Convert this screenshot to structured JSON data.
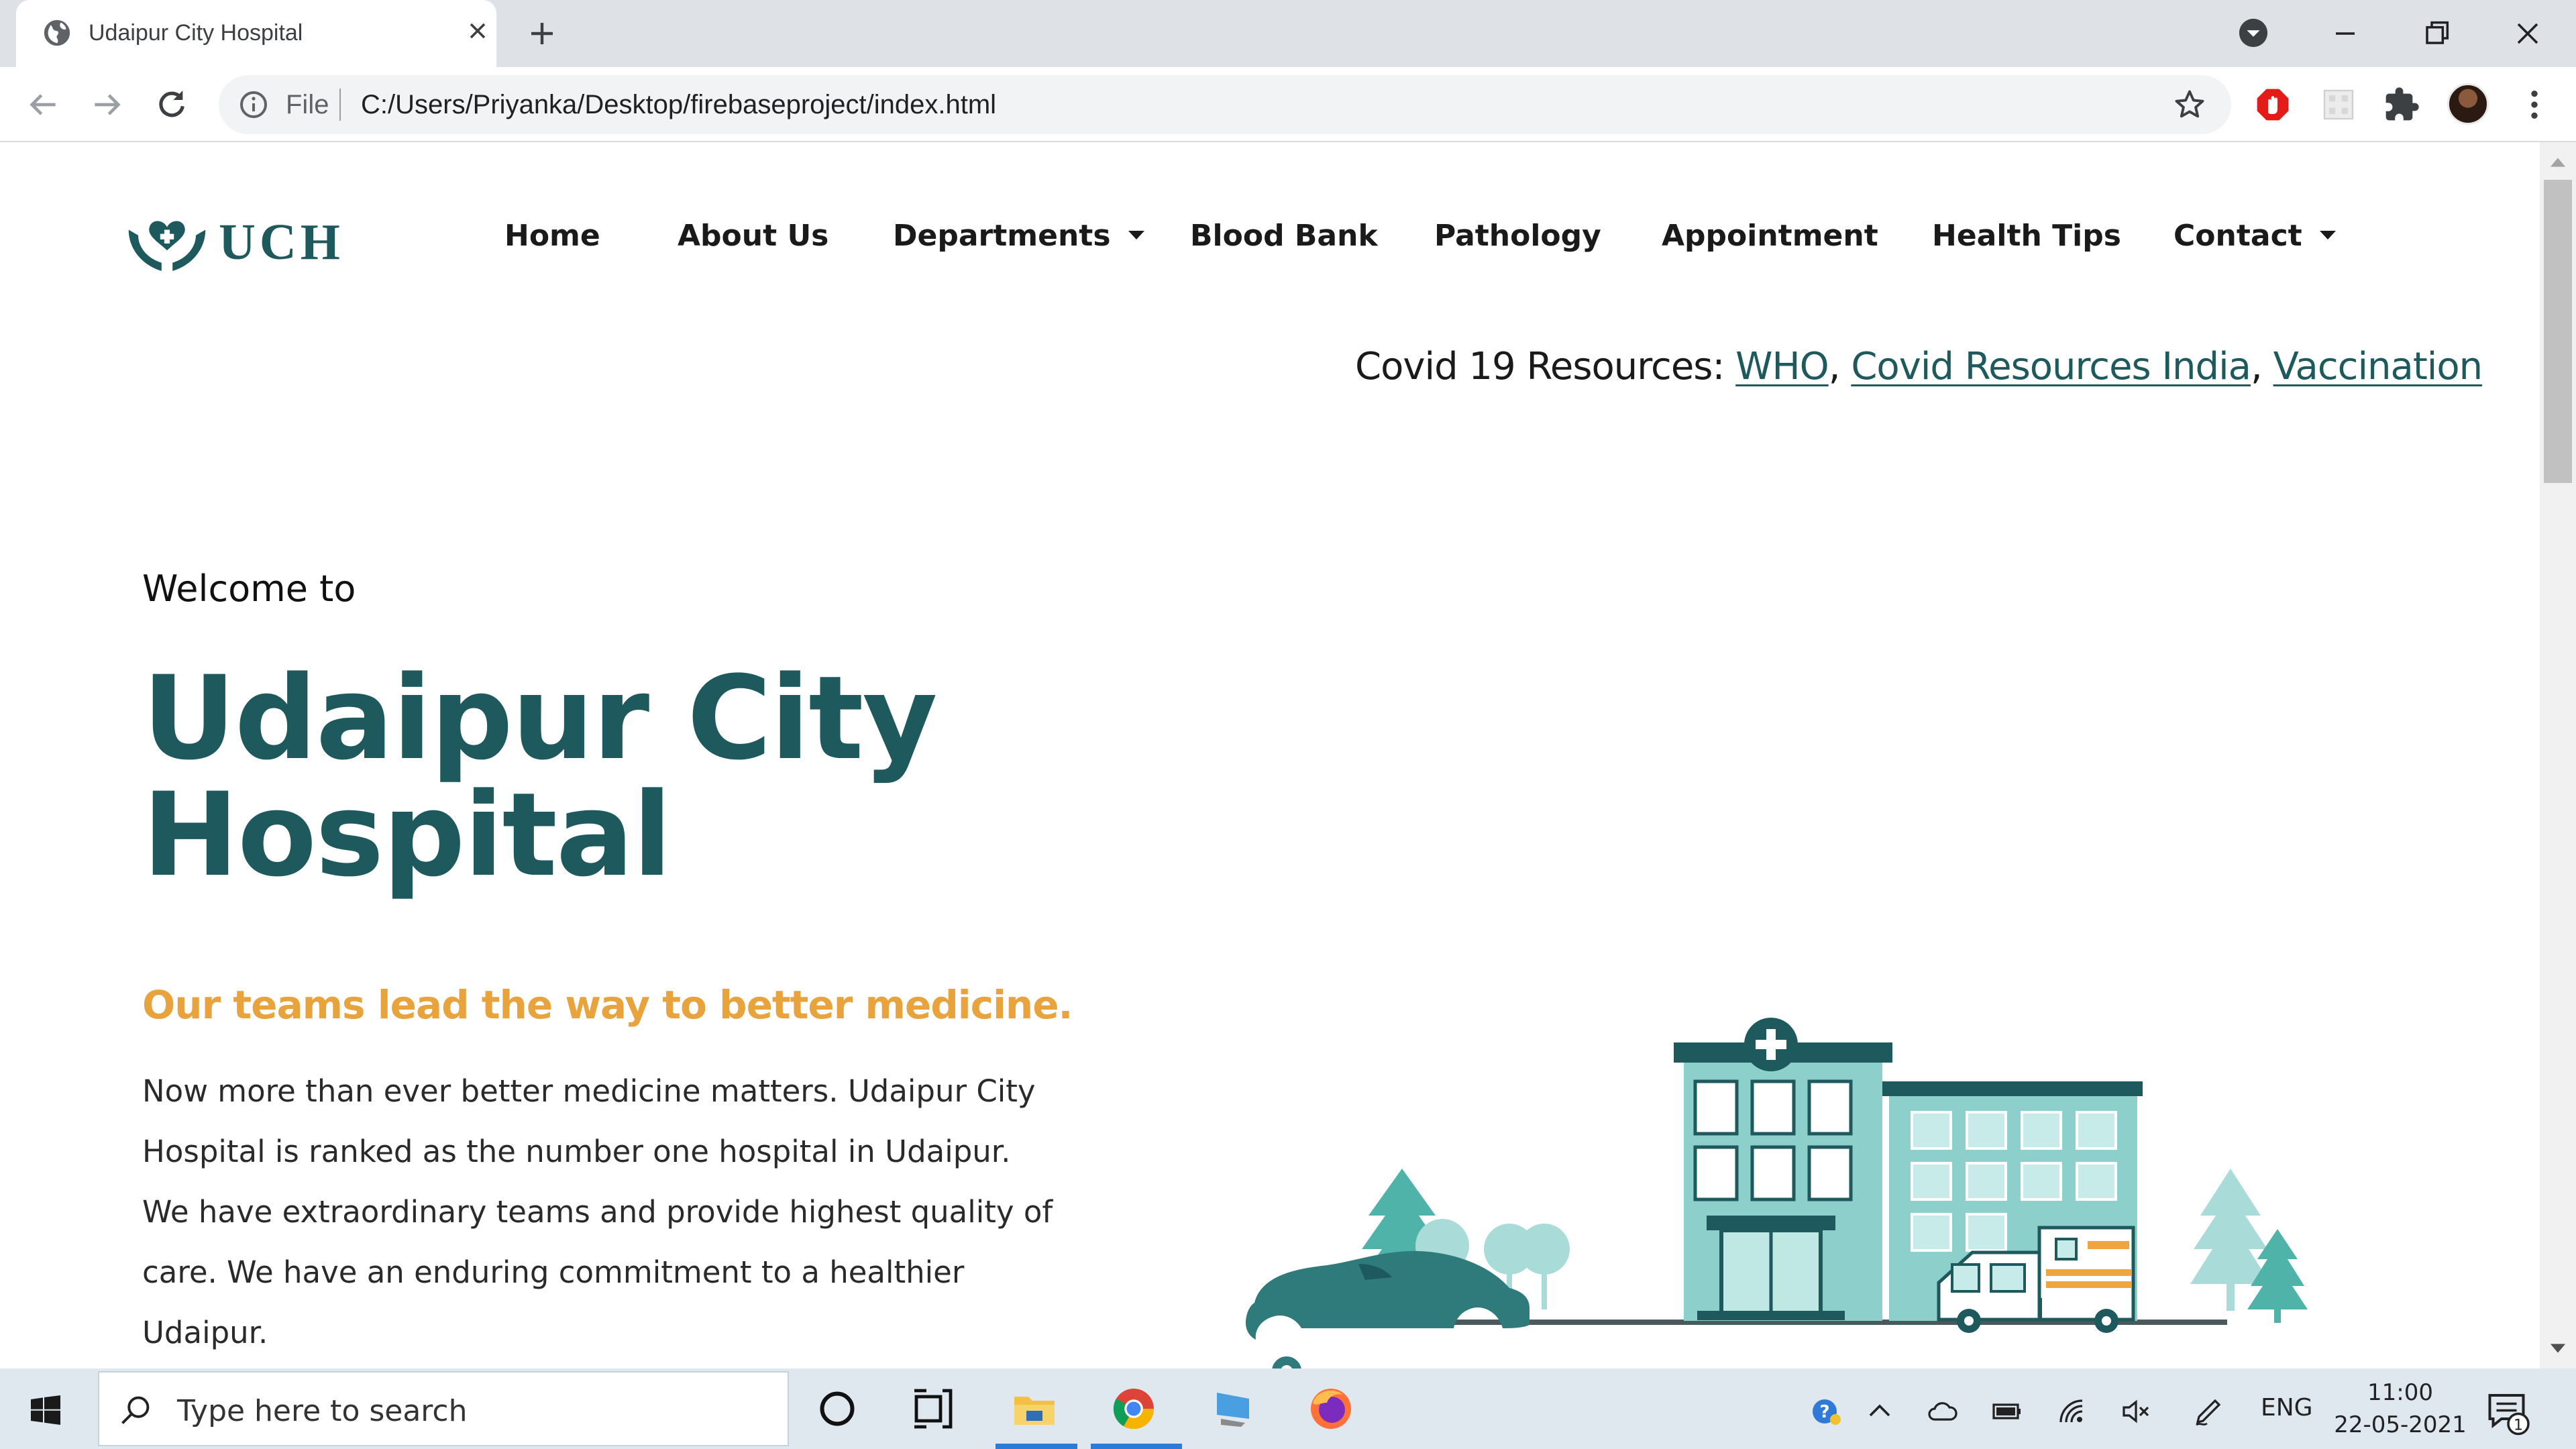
{
  "browser": {
    "tab_title": "Udaipur City Hospital",
    "omnibox_scheme": "File",
    "url": "C:/Users/Priyanka/Desktop/firebaseproject/index.html"
  },
  "site": {
    "logo_text": "UCH",
    "nav": [
      {
        "label": "Home"
      },
      {
        "label": "About Us"
      },
      {
        "label": "Departments",
        "dropdown": true
      },
      {
        "label": "Blood Bank"
      },
      {
        "label": "Pathology"
      },
      {
        "label": "Appointment"
      },
      {
        "label": "Health Tips"
      },
      {
        "label": "Contact",
        "dropdown": true
      }
    ],
    "covid": {
      "prefix": "Covid 19 Resources:",
      "links": [
        "WHO",
        "Covid Resources India",
        "Vaccination"
      ],
      "separator": ","
    },
    "hero": {
      "welcome": "Welcome to",
      "title_line1": "Udaipur City",
      "title_line2": "Hospital",
      "tagline": "Our teams lead the way to better medicine.",
      "intro": "Now more than ever better medicine matters. Udaipur City Hospital is ranked as the number one hospital in Udaipur. We have extraordinary teams and provide highest quality of care. We have an enduring commitment to a healthier Udaipur."
    },
    "colors": {
      "brand": "#1e5a5d",
      "accent": "#e8a33d",
      "building": "#8ccfcb"
    }
  },
  "taskbar": {
    "search_placeholder": "Type here to search",
    "language": "ENG",
    "time": "11:00",
    "date": "22-05-2021",
    "notification_count": "1"
  }
}
